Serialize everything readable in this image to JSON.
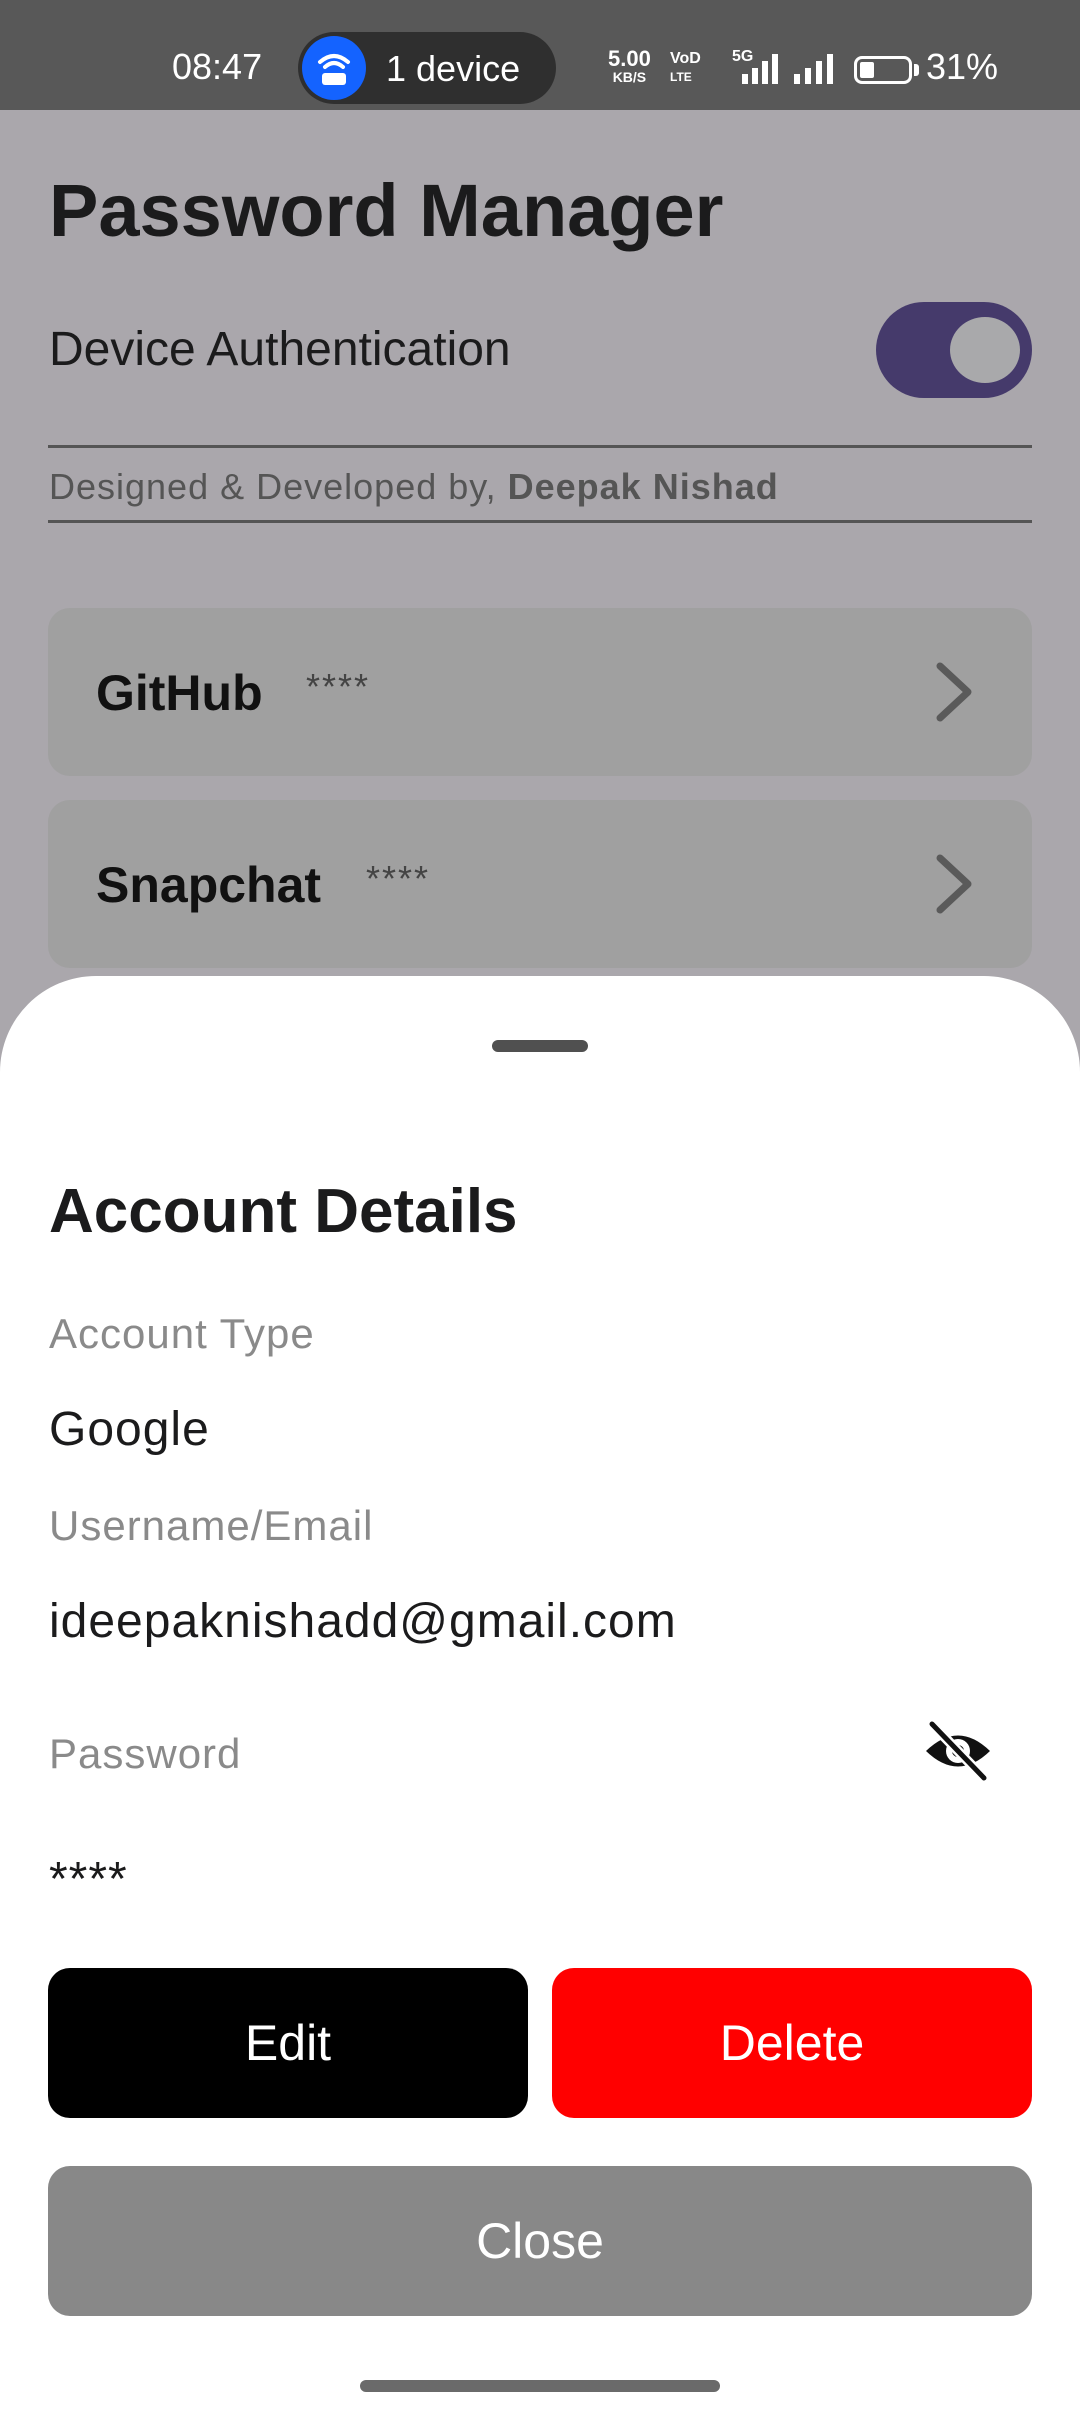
{
  "status_bar": {
    "time": "08:47",
    "hotspot": "1 device",
    "net_speed_value": "5.00",
    "net_speed_unit": "KB/S",
    "volte_top": "VoD",
    "volte_bottom": "LTE",
    "network_type": "5G",
    "battery": "31%",
    "battery_level": 0.31
  },
  "app": {
    "title": "Password Manager",
    "auth_label": "Device Authentication",
    "auth_enabled": true,
    "credit_prefix": "Designed & Developed by,",
    "credit_name": "Deepak Nishad",
    "accounts": [
      {
        "name": "GitHub",
        "masked": "****"
      },
      {
        "name": "Snapchat",
        "masked": "****"
      }
    ]
  },
  "sheet": {
    "title": "Account Details",
    "account_type_label": "Account Type",
    "account_type_value": "Google",
    "username_label": "Username/Email",
    "username_value": "ideepaknishadd@gmail.com",
    "password_label": "Password",
    "password_value": "****",
    "password_visibility_icon": "eye-off-icon",
    "edit_label": "Edit",
    "delete_label": "Delete",
    "close_label": "Close",
    "colors": {
      "edit": "#000000",
      "delete": "#ff0000",
      "close": "#888888"
    }
  }
}
